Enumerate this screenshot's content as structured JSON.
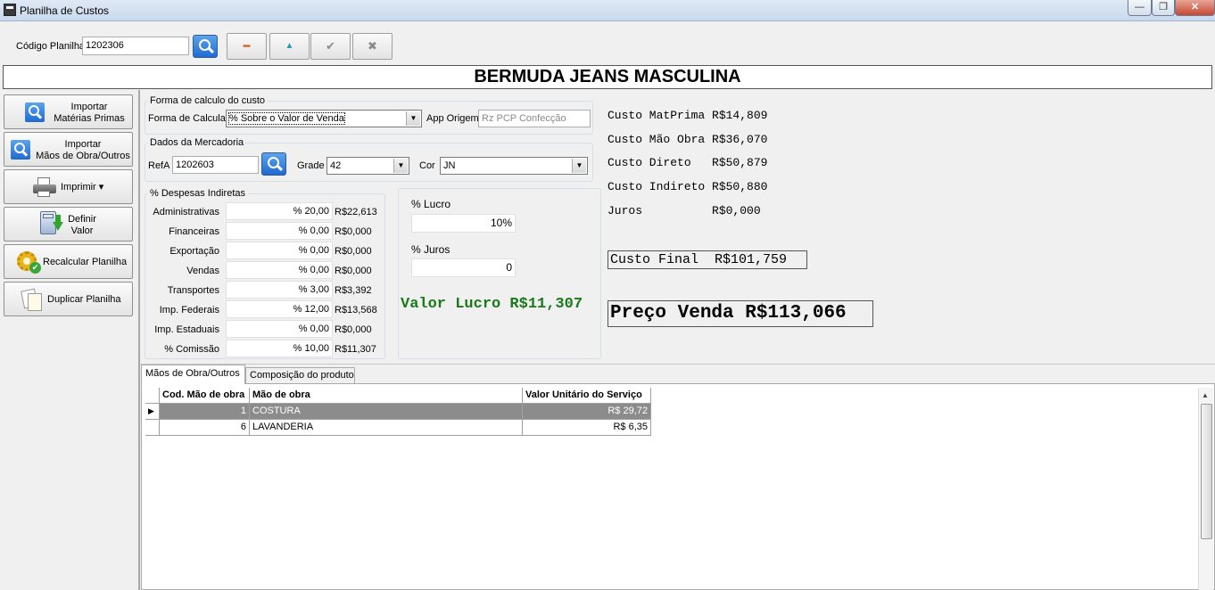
{
  "window": {
    "title": "Planilha de Custos",
    "min": "—",
    "max": "❐",
    "close": "✕"
  },
  "toolbar": {
    "codigo_label": "Código Planilha",
    "codigo_value": "1202306",
    "btn_delete": "━",
    "btn_up": "▲",
    "btn_confirm": "✔",
    "btn_cancel": "✖"
  },
  "product_title": "BERMUDA JEANS MASCULINA",
  "sidebar": {
    "importar_mp": [
      "Importar",
      "Matérias Primas"
    ],
    "importar_mo": [
      "Importar",
      "Mãos de Obra/Outros"
    ],
    "imprimir": "Imprimir ▾",
    "definir": [
      "Definir",
      "Valor"
    ],
    "recalcular": "Recalcular Planilha",
    "duplicar": "Duplicar Planilha"
  },
  "forma_calculo": {
    "group_title": "Forma de calculo do custo",
    "label": "Forma de Calcular",
    "value": "% Sobre o Valor de Venda",
    "app_origem_label": "App Origem",
    "app_origem_value": "Rz PCP Confecção"
  },
  "mercadoria": {
    "group_title": "Dados da Mercadoria",
    "ref_label": "RefA",
    "ref_value": "1202603",
    "grade_label": "Grade",
    "grade_value": "42",
    "cor_label": "Cor",
    "cor_value": "JN"
  },
  "despesas": {
    "group_title": "% Despesas Indiretas",
    "rows": [
      {
        "label": "Administrativas",
        "pct": "% 20,00",
        "valor": "R$22,613"
      },
      {
        "label": "Financeiras",
        "pct": "% 0,00",
        "valor": "R$0,000"
      },
      {
        "label": "Exportação",
        "pct": "% 0,00",
        "valor": "R$0,000"
      },
      {
        "label": "Vendas",
        "pct": "% 0,00",
        "valor": "R$0,000"
      },
      {
        "label": "Transportes",
        "pct": "% 3,00",
        "valor": "R$3,392"
      },
      {
        "label": "Imp. Federais",
        "pct": "% 12,00",
        "valor": "R$13,568"
      },
      {
        "label": "Imp. Estaduais",
        "pct": "% 0,00",
        "valor": "R$0,000"
      },
      {
        "label": "% Comissão",
        "pct": "% 10,00",
        "valor": "R$11,307"
      }
    ]
  },
  "lucro": {
    "lucro_label": "% Lucro",
    "lucro_value": "10%",
    "juros_label": "% Juros",
    "juros_value": "0",
    "valor_lucro": "Valor Lucro R$11,307"
  },
  "resumo": {
    "rows": [
      "Custo MatPrima R$14,809",
      "Custo Mão Obra R$36,070",
      "Custo Direto   R$50,879",
      "Custo Indireto R$50,880",
      "Juros          R$0,000"
    ],
    "custo_final": "Custo Final  R$101,759",
    "preco_venda": "Preço Venda R$113,066"
  },
  "tabs": [
    "Mãos de Obra/Outros",
    "Composição do produto"
  ],
  "grid": {
    "columns": [
      "Cod. Mão de obra",
      "Mão de obra",
      "Valor Unitário do Serviço"
    ],
    "rows": [
      [
        "1",
        "COSTURA",
        "R$ 29,72"
      ],
      [
        "6",
        "LAVANDERIA",
        "R$ 6,35"
      ]
    ]
  },
  "colors": {
    "accent_blue": "#1f6ad1",
    "lucro_green": "#1a7a1a"
  }
}
